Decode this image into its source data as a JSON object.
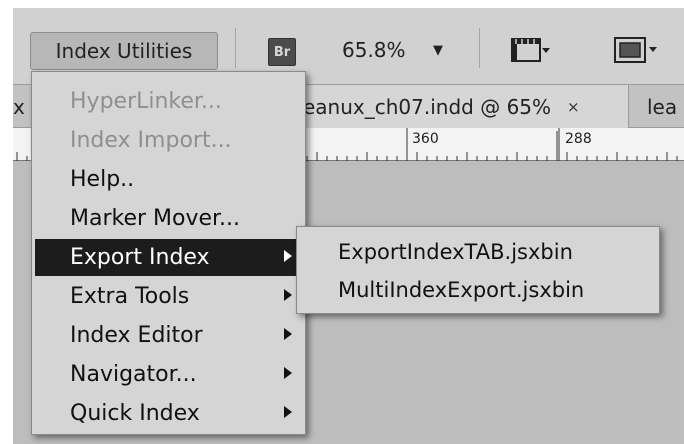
{
  "toolbar": {
    "menu_button": "Index Utilities",
    "bridge_button": "Br",
    "zoom": "65.8%"
  },
  "tabs": [
    {
      "label": "x",
      "active": false
    },
    {
      "label": "eanux_ch07.indd @ 65%",
      "active": true,
      "close": "×"
    },
    {
      "label": "lea",
      "active": false
    }
  ],
  "ruler": {
    "labels": [
      "360",
      "288"
    ]
  },
  "menu": {
    "items": [
      {
        "label": "HyperLinker...",
        "disabled": true,
        "submenu": false
      },
      {
        "label": "Index Import...",
        "disabled": true,
        "submenu": false
      },
      {
        "label": "Help..",
        "disabled": false,
        "submenu": false
      },
      {
        "label": "Marker Mover...",
        "disabled": false,
        "submenu": false
      },
      {
        "label": "Export Index",
        "disabled": false,
        "submenu": true,
        "highlighted": true
      },
      {
        "label": "Extra Tools",
        "disabled": false,
        "submenu": true
      },
      {
        "label": "Index Editor",
        "disabled": false,
        "submenu": true
      },
      {
        "label": "Navigator...",
        "disabled": false,
        "submenu": true
      },
      {
        "label": "Quick Index",
        "disabled": false,
        "submenu": true
      }
    ]
  },
  "submenu": {
    "items": [
      {
        "label": "ExportIndexTAB.jsxbin"
      },
      {
        "label": "MultiIndexExport.jsxbin"
      }
    ]
  },
  "colors": {
    "highlight": "#1c1c1c",
    "menu_bg": "#d5d5d5",
    "toolbar_bg": "#d1d1d1"
  }
}
